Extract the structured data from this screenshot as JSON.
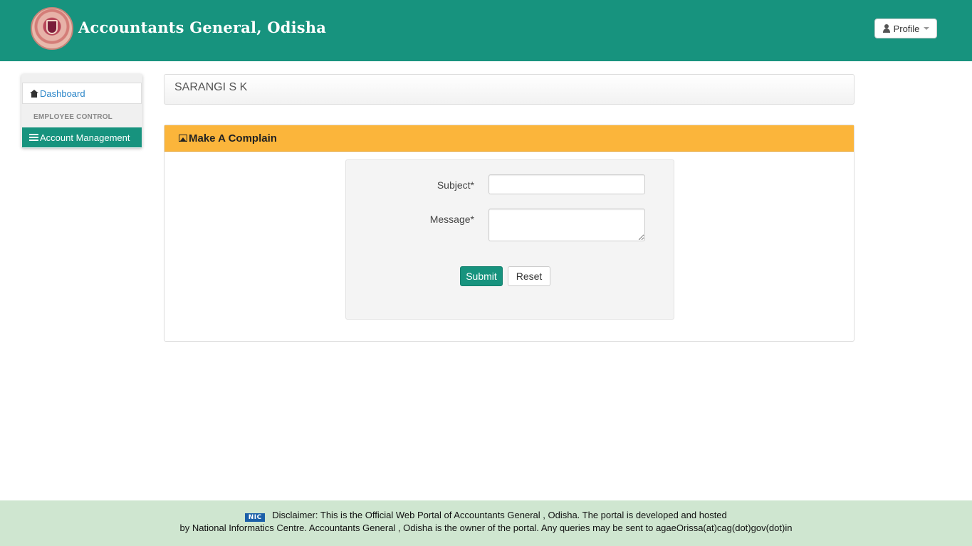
{
  "header": {
    "brand": "Accountants General, Odisha",
    "profile_label": "Profile"
  },
  "sidebar": {
    "items": [
      {
        "label": "Dashboard",
        "icon": "home-icon"
      },
      {
        "label": "Account Management",
        "icon": "list-icon"
      }
    ],
    "section_header": "EMPLOYEE CONTROL"
  },
  "user": {
    "name": "SARANGI S K"
  },
  "complaint": {
    "title": "Make A Complain",
    "icon": "picture-icon",
    "subject_label": "Subject*",
    "message_label": "Message*",
    "subject_value": "",
    "message_value": "",
    "submit_label": "Submit",
    "reset_label": "Reset"
  },
  "footer": {
    "logo_text": "NIC",
    "line1": "Disclaimer: This is the Official Web Portal of Accountants General , Odisha. The portal is developed and hosted",
    "line2": "by National Informatics Centre. Accountants General , Odisha is the owner of the portal. Any queries may be sent to agaeOrissa(at)cag(dot)gov(dot)in"
  },
  "colors": {
    "header_bg": "#17937e",
    "panel_header_bg": "#fbb53b",
    "footer_bg": "#cfe6d0",
    "link": "#2a85c8"
  }
}
